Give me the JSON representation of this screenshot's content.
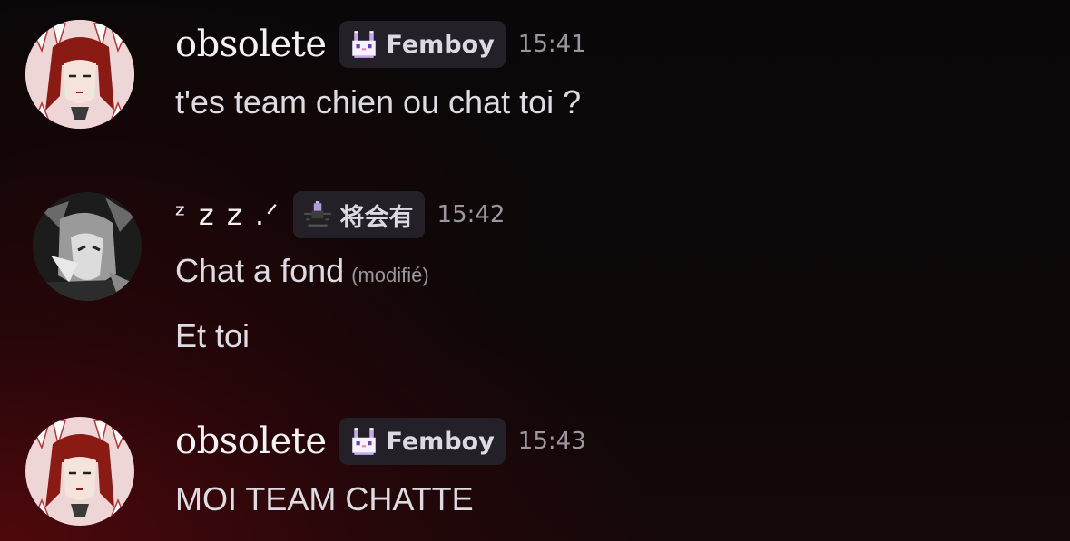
{
  "messages": [
    {
      "username": "obsolete",
      "tag": {
        "label": "Femboy",
        "icon": "bunny-icon"
      },
      "time": "15:41",
      "lines": [
        "t'es team chien ou chat toi ?"
      ]
    },
    {
      "username": "ᶻ z 𝗓 .ᐟ",
      "tag": {
        "label": "将会有",
        "icon": "spider-icon"
      },
      "time": "15:42",
      "lines": [
        "Chat a fond",
        "Et toi"
      ],
      "edited": "(modifié)"
    },
    {
      "username": "obsolete",
      "tag": {
        "label": "Femboy",
        "icon": "bunny-icon"
      },
      "time": "15:43",
      "lines": [
        "MOI TEAM CHATTE"
      ]
    }
  ],
  "colors": {
    "username": "#f2f2f4",
    "tag_bg": "#232127",
    "timestamp": "#9a979e",
    "message_text": "#dedce2",
    "accent_red": "#5f080e"
  }
}
